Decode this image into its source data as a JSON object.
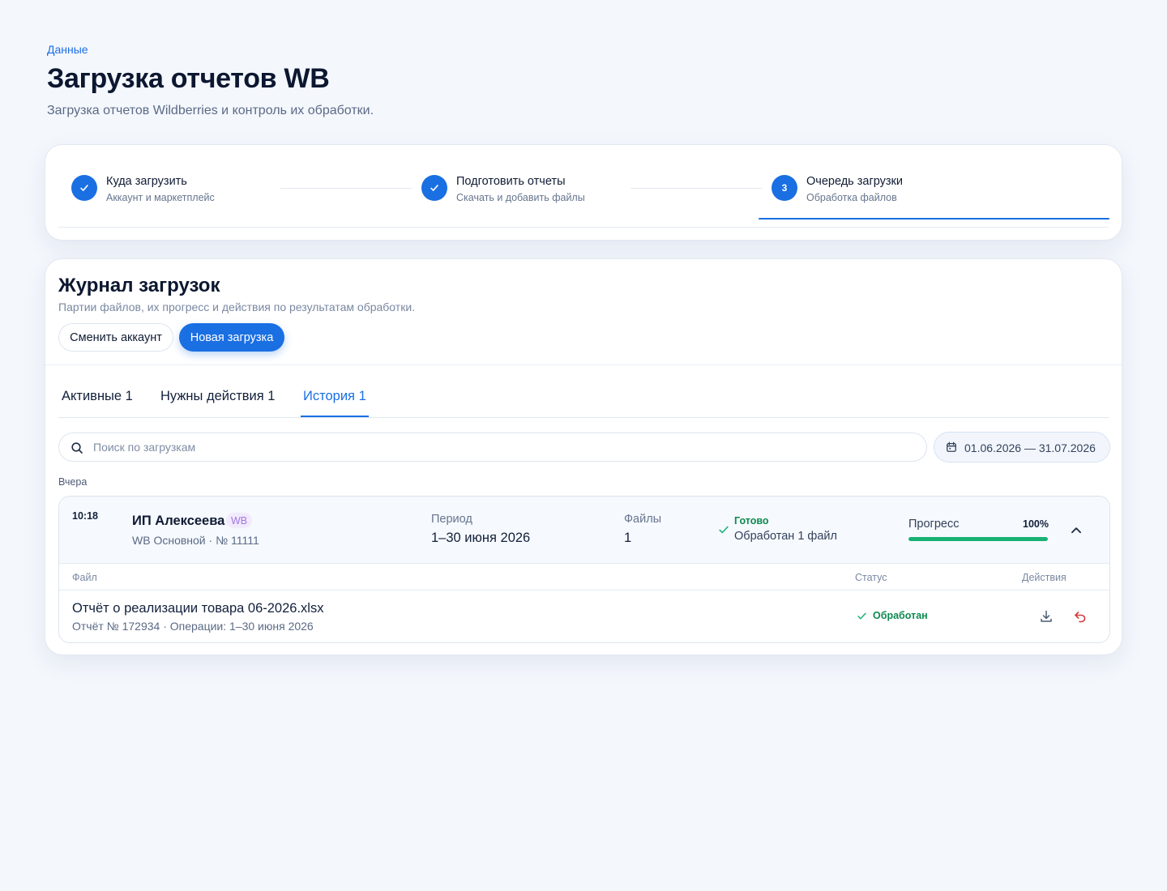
{
  "breadcrumb": "Данные",
  "page": {
    "title": "Загрузка отчетов WB",
    "subtitle": "Загрузка отчетов Wildberries и контроль их обработки."
  },
  "stepper": {
    "steps": [
      {
        "title": "Куда загрузить",
        "subtitle": "Аккаунт и маркетплейс",
        "state": "done",
        "icon": "check-icon"
      },
      {
        "title": "Подготовить отчеты",
        "subtitle": "Скачать и добавить файлы",
        "state": "done",
        "icon": "check-icon"
      },
      {
        "number": "3",
        "title": "Очередь загрузки",
        "subtitle": "Обработка файлов",
        "state": "active"
      }
    ]
  },
  "journal": {
    "title": "Журнал загрузок",
    "subtitle": "Партии файлов, их прогресс и действия по результатам обработки.",
    "switch_account_label": "Сменить аккаунт",
    "new_upload_label": "Новая загрузка"
  },
  "tabs": [
    {
      "label": "Активные 1",
      "active": false
    },
    {
      "label": "Нужны действия 1",
      "active": false
    },
    {
      "label": "История 1",
      "active": true
    }
  ],
  "search": {
    "placeholder": "Поиск по загрузкам",
    "value": ""
  },
  "date_range": {
    "label": "01.06.2026 — 31.07.2026",
    "icon": "calendar-icon"
  },
  "groups": [
    {
      "label": "Вчера",
      "batch": {
        "time": "10:18",
        "name": "ИП Алексеева",
        "badge": "WB",
        "account": "WB Основной · № 11111",
        "period_label": "Период",
        "period_value": "1–30 июня 2026",
        "files_label": "Файлы",
        "files_value": "1",
        "status_title": "Готово",
        "status_desc": "Обработан 1 файл",
        "progress_label": "Прогресс",
        "progress_text": "100%",
        "progress_fraction": 1.0,
        "files_table": {
          "columns": [
            "Файл",
            "Статус",
            "Действия"
          ],
          "rows": [
            {
              "name": "Отчёт о реализации товара 06-2026.xlsx",
              "meta": "Отчёт № 172934 · Операции: 1–30 июня 2026",
              "status": "Обработан",
              "actions": [
                "download-icon",
                "undo-icon"
              ]
            }
          ]
        }
      }
    }
  ],
  "colors": {
    "accent": "#1a6fe2",
    "success": "#17b174",
    "success_text": "#0e8a4f",
    "danger": "#d63a3a",
    "badge_bg": "#f2eafd",
    "badge_text": "#a278e0"
  }
}
